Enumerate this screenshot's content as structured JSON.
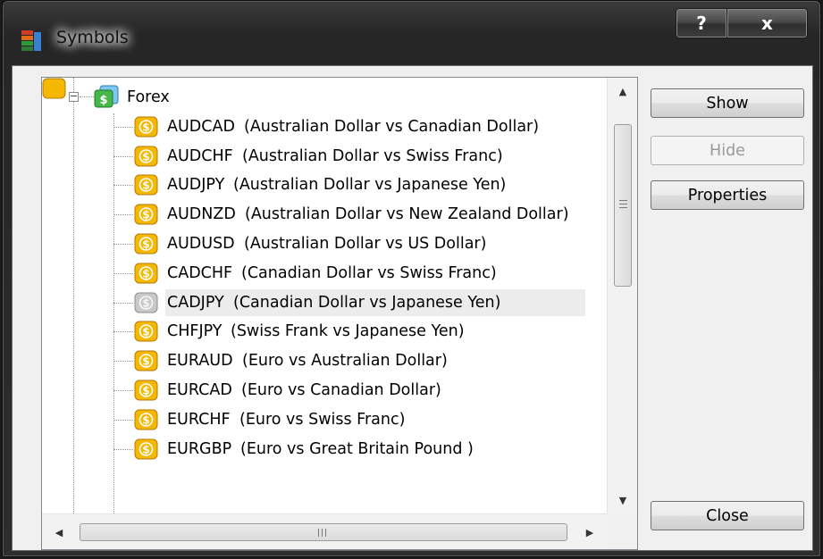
{
  "window": {
    "title": "Symbols",
    "help_label": "?",
    "close_label": "x"
  },
  "tree": {
    "root": {
      "label": "Forex",
      "expanded": true
    },
    "items": [
      {
        "symbol": "AUDCAD",
        "description": "(Australian Dollar vs Canadian Dollar)",
        "enabled": true
      },
      {
        "symbol": "AUDCHF",
        "description": "(Australian Dollar vs Swiss Franc)",
        "enabled": true
      },
      {
        "symbol": "AUDJPY",
        "description": "(Australian Dollar vs Japanese Yen)",
        "enabled": true
      },
      {
        "symbol": "AUDNZD",
        "description": "(Australian Dollar vs New Zealand Dollar)",
        "enabled": true
      },
      {
        "symbol": "AUDUSD",
        "description": "(Australian Dollar vs US Dollar)",
        "enabled": true
      },
      {
        "symbol": "CADCHF",
        "description": "(Canadian Dollar vs Swiss Franc)",
        "enabled": true
      },
      {
        "symbol": "CADJPY",
        "description": "(Canadian Dollar vs Japanese Yen)",
        "enabled": false,
        "selected": true
      },
      {
        "symbol": "CHFJPY",
        "description": "(Swiss Frank vs Japanese Yen)",
        "enabled": true
      },
      {
        "symbol": "EURAUD",
        "description": "(Euro vs Australian Dollar)",
        "enabled": true
      },
      {
        "symbol": "EURCAD",
        "description": "(Euro vs Canadian Dollar)",
        "enabled": true
      },
      {
        "symbol": "EURCHF",
        "description": "(Euro vs Swiss Franc)",
        "enabled": true
      },
      {
        "symbol": "EURGBP",
        "description": "(Euro vs Great Britain Pound )",
        "enabled": true
      }
    ]
  },
  "buttons": {
    "show": "Show",
    "hide": "Hide",
    "properties": "Properties",
    "close": "Close"
  },
  "icons": {
    "symbol_icon": "dollar-coin-icon",
    "folder_icon": "forex-folder-icon",
    "app_icon": "symbols-app-icon"
  },
  "colors": {
    "symbol_active": "#f5b800",
    "symbol_inactive": "#c8c8c8"
  }
}
